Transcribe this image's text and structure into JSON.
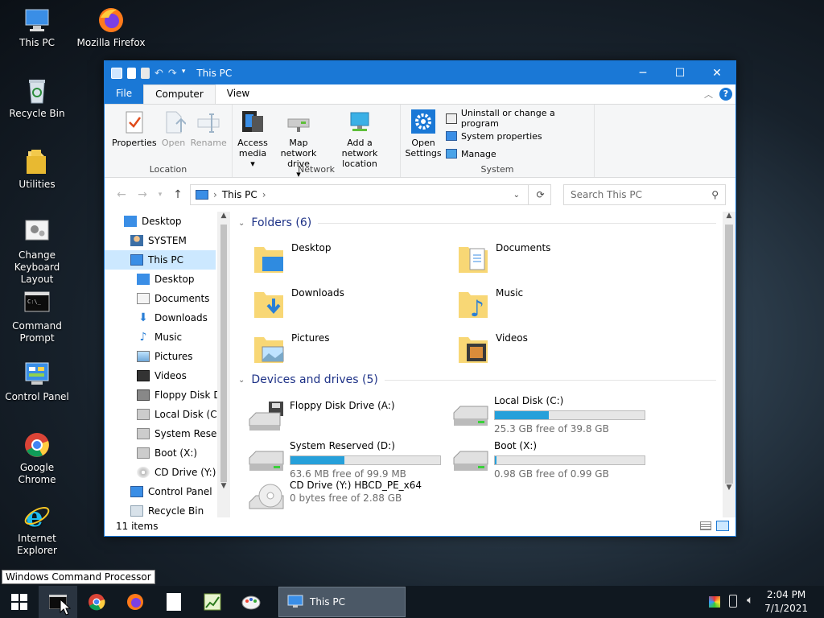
{
  "desktop": {
    "icons": [
      {
        "label": "This PC"
      },
      {
        "label": "Mozilla Firefox"
      },
      {
        "label": "Recycle Bin"
      },
      {
        "label": "Utilities"
      },
      {
        "label": "Change Keyboard Layout"
      },
      {
        "label": "Command Prompt"
      },
      {
        "label": "Control Panel"
      },
      {
        "label": "Google Chrome"
      },
      {
        "label": "Internet Explorer"
      }
    ]
  },
  "window": {
    "title": "This PC",
    "tabs": {
      "file": "File",
      "computer": "Computer",
      "view": "View"
    },
    "ribbon": {
      "location": {
        "label": "Location",
        "properties": "Properties",
        "open": "Open",
        "rename": "Rename"
      },
      "network": {
        "label": "Network",
        "access_media": "Access media",
        "map_drive": "Map network drive",
        "add_location": "Add a network location"
      },
      "system": {
        "label": "System",
        "open_settings": "Open Settings",
        "uninstall": "Uninstall or change a program",
        "sys_props": "System properties",
        "manage": "Manage"
      }
    },
    "address": {
      "path": "This PC",
      "search_placeholder": "Search This PC"
    },
    "nav": [
      {
        "label": "Desktop"
      },
      {
        "label": "SYSTEM"
      },
      {
        "label": "This PC"
      },
      {
        "label": "Desktop"
      },
      {
        "label": "Documents"
      },
      {
        "label": "Downloads"
      },
      {
        "label": "Music"
      },
      {
        "label": "Pictures"
      },
      {
        "label": "Videos"
      },
      {
        "label": "Floppy Disk Dri"
      },
      {
        "label": "Local Disk (C:)"
      },
      {
        "label": "System Reserve"
      },
      {
        "label": "Boot (X:)"
      },
      {
        "label": "CD Drive (Y:) H"
      },
      {
        "label": "Control Panel"
      },
      {
        "label": "Recycle Bin"
      }
    ],
    "folders_header": "Folders (6)",
    "folders": [
      {
        "name": "Desktop"
      },
      {
        "name": "Documents"
      },
      {
        "name": "Downloads"
      },
      {
        "name": "Music"
      },
      {
        "name": "Pictures"
      },
      {
        "name": "Videos"
      }
    ],
    "drives_header": "Devices and drives (5)",
    "drives": [
      {
        "name": "Floppy Disk Drive (A:)",
        "free": "",
        "used_fraction": null
      },
      {
        "name": "Local Disk (C:)",
        "free": "25.3 GB free of 39.8 GB",
        "used_fraction": 0.36
      },
      {
        "name": "System Reserved (D:)",
        "free": "63.6 MB free of 99.9 MB",
        "used_fraction": 0.36
      },
      {
        "name": "Boot (X:)",
        "free": "0.98 GB free of 0.99 GB",
        "used_fraction": 0.01
      },
      {
        "name": "CD Drive (Y:) HBCD_PE_x64",
        "free": "0 bytes free of 2.88 GB",
        "used_fraction": null
      }
    ],
    "status": "11 items"
  },
  "tooltip": "Windows Command Processor",
  "taskbar": {
    "active_window": "This PC",
    "time": "2:04 PM",
    "date": "7/1/2021"
  },
  "colors": {
    "accent": "#1a78d6",
    "bar_fill": "#26a0da",
    "selection": "#cce8ff",
    "header_text": "#1e3287"
  }
}
